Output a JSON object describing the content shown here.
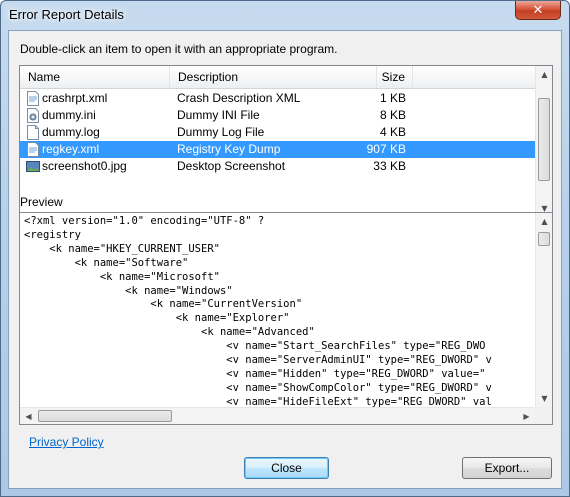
{
  "window": {
    "title": "Error Report Details",
    "close_glyph": "✕"
  },
  "instruction": "Double-click an item to open it with an appropriate program.",
  "files": {
    "columns": {
      "name": "Name",
      "description": "Description",
      "size": "Size"
    },
    "rows": [
      {
        "name": "crashrpt.xml",
        "description": "Crash Description XML",
        "size": "1 KB",
        "icon": "xml-file-icon",
        "selected": false
      },
      {
        "name": "dummy.ini",
        "description": "Dummy INI File",
        "size": "8 KB",
        "icon": "ini-file-icon",
        "selected": false
      },
      {
        "name": "dummy.log",
        "description": "Dummy Log File",
        "size": "4 KB",
        "icon": "text-file-icon",
        "selected": false
      },
      {
        "name": "regkey.xml",
        "description": "Registry Key Dump",
        "size": "907 KB",
        "icon": "xml-file-icon",
        "selected": true
      },
      {
        "name": "screenshot0.jpg",
        "description": "Desktop Screenshot",
        "size": "33 KB",
        "icon": "image-file-icon",
        "selected": false
      }
    ]
  },
  "preview": {
    "label": "Preview",
    "text": "<?xml version=\"1.0\" encoding=\"UTF-8\" ?\n<registry\n    <k name=\"HKEY_CURRENT_USER\"\n        <k name=\"Software\"\n            <k name=\"Microsoft\"\n                <k name=\"Windows\"\n                    <k name=\"CurrentVersion\"\n                        <k name=\"Explorer\"\n                            <k name=\"Advanced\"\n                                <v name=\"Start_SearchFiles\" type=\"REG_DWO\n                                <v name=\"ServerAdminUI\" type=\"REG_DWORD\" v\n                                <v name=\"Hidden\" type=\"REG_DWORD\" value=\"\n                                <v name=\"ShowCompColor\" type=\"REG_DWORD\" v\n                                <v name=\"HideFileExt\" type=\"REG_DWORD\" val"
  },
  "footer": {
    "privacy_link": "Privacy Policy",
    "close_button": "Close",
    "export_button": "Export..."
  },
  "colors": {
    "selection": "#3399ff",
    "link": "#0066cc",
    "title_gradient": "#b9d1ea"
  }
}
